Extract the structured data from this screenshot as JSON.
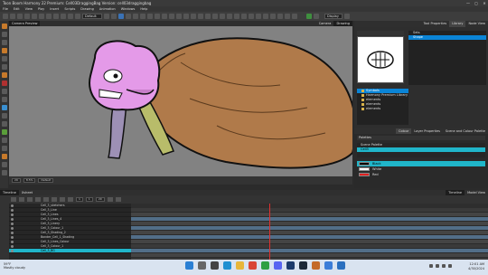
{
  "window": {
    "title": "Toon Boom Harmony 22 Premium: Cell03DraggingBag Version: cell03draggingbag",
    "controls": [
      "—",
      "▢",
      "✕"
    ]
  },
  "menu": [
    "File",
    "Edit",
    "View",
    "Play",
    "Insert",
    "Scripts",
    "Drawing",
    "Animation",
    "Windows",
    "Help"
  ],
  "toolbar": {
    "select_value": "Default",
    "display_value": "Display"
  },
  "view_tabs": {
    "left": [
      "Camera Preview"
    ],
    "right": [
      "Camera",
      "Drawing"
    ]
  },
  "view_status": [
    "29",
    "8.5%",
    "Default"
  ],
  "right_tabs": [
    "Tool Properties",
    "Library",
    "Node View"
  ],
  "library": {
    "list": [
      "Sets",
      "Shape"
    ],
    "tree": [
      "Symbols",
      "Harmony Premium Library",
      "elements",
      "elements",
      "elements"
    ]
  },
  "colour_tabs": [
    "Colour",
    "Layer Properties",
    "Scene and Colour Palette"
  ],
  "colour": {
    "header": "Palettes",
    "palettes": [
      "Scene Palette",
      "Cell3"
    ],
    "swatches": [
      {
        "name": "Black",
        "color": "#000000"
      },
      {
        "name": "White",
        "color": "#ffffff"
      },
      {
        "name": "Red",
        "color": "#e02020"
      }
    ]
  },
  "timeline_tabs": {
    "left": [
      "Timeline",
      "Xsheet"
    ],
    "right": [
      "Timeline",
      "Model View"
    ]
  },
  "timeline": {
    "frame": "1",
    "start": "1",
    "end": "29",
    "layers": [
      {
        "name": "Cell_3_sketchers"
      },
      {
        "name": "Cell_3_Line"
      },
      {
        "name": "Cell_3_Lines"
      },
      {
        "name": "Cell_3_Lines_4"
      },
      {
        "name": "Cell_3_Linery"
      },
      {
        "name": "Cell_3_Colour_1"
      },
      {
        "name": "Cell_3_Shading_2"
      },
      {
        "name": "Bonder_Cell_1_Shading"
      },
      {
        "name": "Cell_3_Lines_Colour"
      },
      {
        "name": "Cell_3_Colour_1"
      },
      {
        "name": "Cell_3_BG"
      }
    ]
  },
  "taskbar": {
    "weather_temp": "59°F",
    "weather_desc": "Mostly cloudy",
    "time": "12:01 AM",
    "date": "4/30/2024"
  },
  "colors": {
    "accent": "#20b5c9",
    "selection": "#0a84d6",
    "character_pink": "#e49ae8",
    "bag_brown": "#b07a4a",
    "leg_purple": "#9d90b5",
    "leg_green": "#b8bc6a"
  }
}
